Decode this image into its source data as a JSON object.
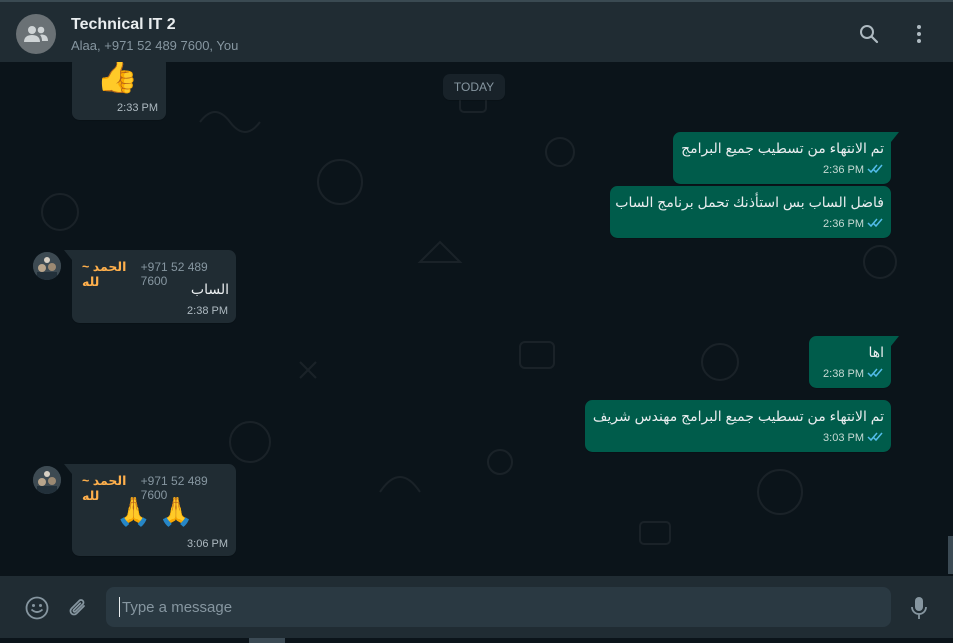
{
  "header": {
    "title": "Technical IT 2",
    "subtitle": "Alaa, +971 52 489 7600, You",
    "icons": [
      "group-avatar-icon",
      "search-icon",
      "menu-icon"
    ]
  },
  "chat": {
    "date_label": "TODAY",
    "messages": [
      {
        "direction": "in",
        "emoji": "👍",
        "time": "2:33 PM"
      },
      {
        "direction": "out",
        "text": "تم الانتهاء من تسطيب جميع البرامج",
        "time": "2:36 PM",
        "status": "read"
      },
      {
        "direction": "out",
        "text": "فاضل الساب بس استأذنك تحمل برنامج الساب",
        "time": "2:36 PM",
        "status": "read"
      },
      {
        "direction": "in",
        "sender": "~ الحمد لله",
        "phone": "+971 52 489 7600",
        "text": "الساب",
        "time": "2:38 PM"
      },
      {
        "direction": "out",
        "text": "اها",
        "time": "2:38 PM",
        "status": "read"
      },
      {
        "direction": "out",
        "text": "تم الانتهاء من تسطيب جميع البرامج مهندس شريف",
        "time": "3:03 PM",
        "status": "read"
      },
      {
        "direction": "in",
        "sender": "~ الحمد لله",
        "phone": "+971 52 489 7600",
        "emoji": "🙏 🙏",
        "time": "3:06 PM"
      }
    ]
  },
  "composer": {
    "placeholder": "Type a message",
    "icons": [
      "emoji-icon",
      "attach-icon",
      "mic-icon"
    ]
  },
  "colors": {
    "background": "#0b141a",
    "header": "#202c33",
    "incoming_bubble": "#202c33",
    "outgoing_bubble": "#005c4b",
    "sender_name": "#ffb04c",
    "read_ticks": "#53bdeb"
  }
}
